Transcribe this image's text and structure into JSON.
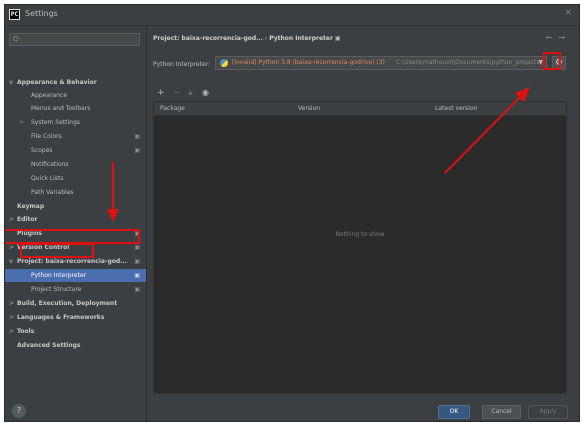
{
  "window": {
    "title": "Settings",
    "logo_text": "PC",
    "close_glyph": "×"
  },
  "search": {
    "icon_glyph": "Q·"
  },
  "sidebar": {
    "items": [
      {
        "label": "Appearance & Behavior",
        "bold": true,
        "arrow": "v",
        "level": 0
      },
      {
        "label": "Appearance",
        "level": 1
      },
      {
        "label": "Menus and Toolbars",
        "level": 1
      },
      {
        "label": "System Settings",
        "arrow": ">",
        "level": 1
      },
      {
        "label": "File Colors",
        "level": 1,
        "indicator": "▣"
      },
      {
        "label": "Scopes",
        "level": 1,
        "indicator": "▣"
      },
      {
        "label": "Notifications",
        "level": 1
      },
      {
        "label": "Quick Lists",
        "level": 1
      },
      {
        "label": "Path Variables",
        "level": 1
      },
      {
        "label": "Keymap",
        "bold": true,
        "level": 0
      },
      {
        "label": "Editor",
        "bold": true,
        "arrow": ">",
        "level": 0
      },
      {
        "label": "Plugins",
        "bold": true,
        "level": 0,
        "indicator": "▣"
      },
      {
        "label": "Version Control",
        "bold": true,
        "arrow": ">",
        "level": 0,
        "indicator": "▣"
      },
      {
        "label": "Project: baixa-recorrencia-god...",
        "bold": true,
        "arrow": "v",
        "level": 0,
        "indicator": "▣"
      },
      {
        "label": "Python Interpreter",
        "level": 1,
        "indicator": "▣",
        "selected": true
      },
      {
        "label": "Project Structure",
        "level": 1,
        "indicator": "▣"
      },
      {
        "label": "Build, Execution, Deployment",
        "bold": true,
        "arrow": ">",
        "level": 0
      },
      {
        "label": "Languages & Frameworks",
        "bold": true,
        "arrow": ">",
        "level": 0
      },
      {
        "label": "Tools",
        "bold": true,
        "arrow": ">",
        "level": 0
      },
      {
        "label": "Advanced Settings",
        "bold": true,
        "level": 0
      }
    ]
  },
  "breadcrumb": {
    "project": "Project: baixa-recorrencia-god...",
    "separator": "›",
    "page": "Python Interpreter",
    "page_icon": "▣"
  },
  "nav": {
    "back": "←",
    "forward": "→"
  },
  "interpreter": {
    "label": "Python Interpreter:",
    "name": "[invalid] Python 3.8 (baixa-recorrencia-godrive) (3)",
    "path": "C:\\Users\\matheush\\Documents\\python_projects\\",
    "dropdown_glyph": "▼",
    "settings_glyph": "⚙"
  },
  "toolbar": {
    "add": "+",
    "remove": "−",
    "up": "▲",
    "show": "◉"
  },
  "table": {
    "columns": [
      "Package",
      "Version",
      "Latest version"
    ],
    "rows": [],
    "empty_text": "Nothing to show"
  },
  "help": {
    "glyph": "?"
  },
  "buttons": {
    "ok": "OK",
    "cancel": "Cancel",
    "apply": "Apply"
  },
  "annotation_color": "#e01010"
}
